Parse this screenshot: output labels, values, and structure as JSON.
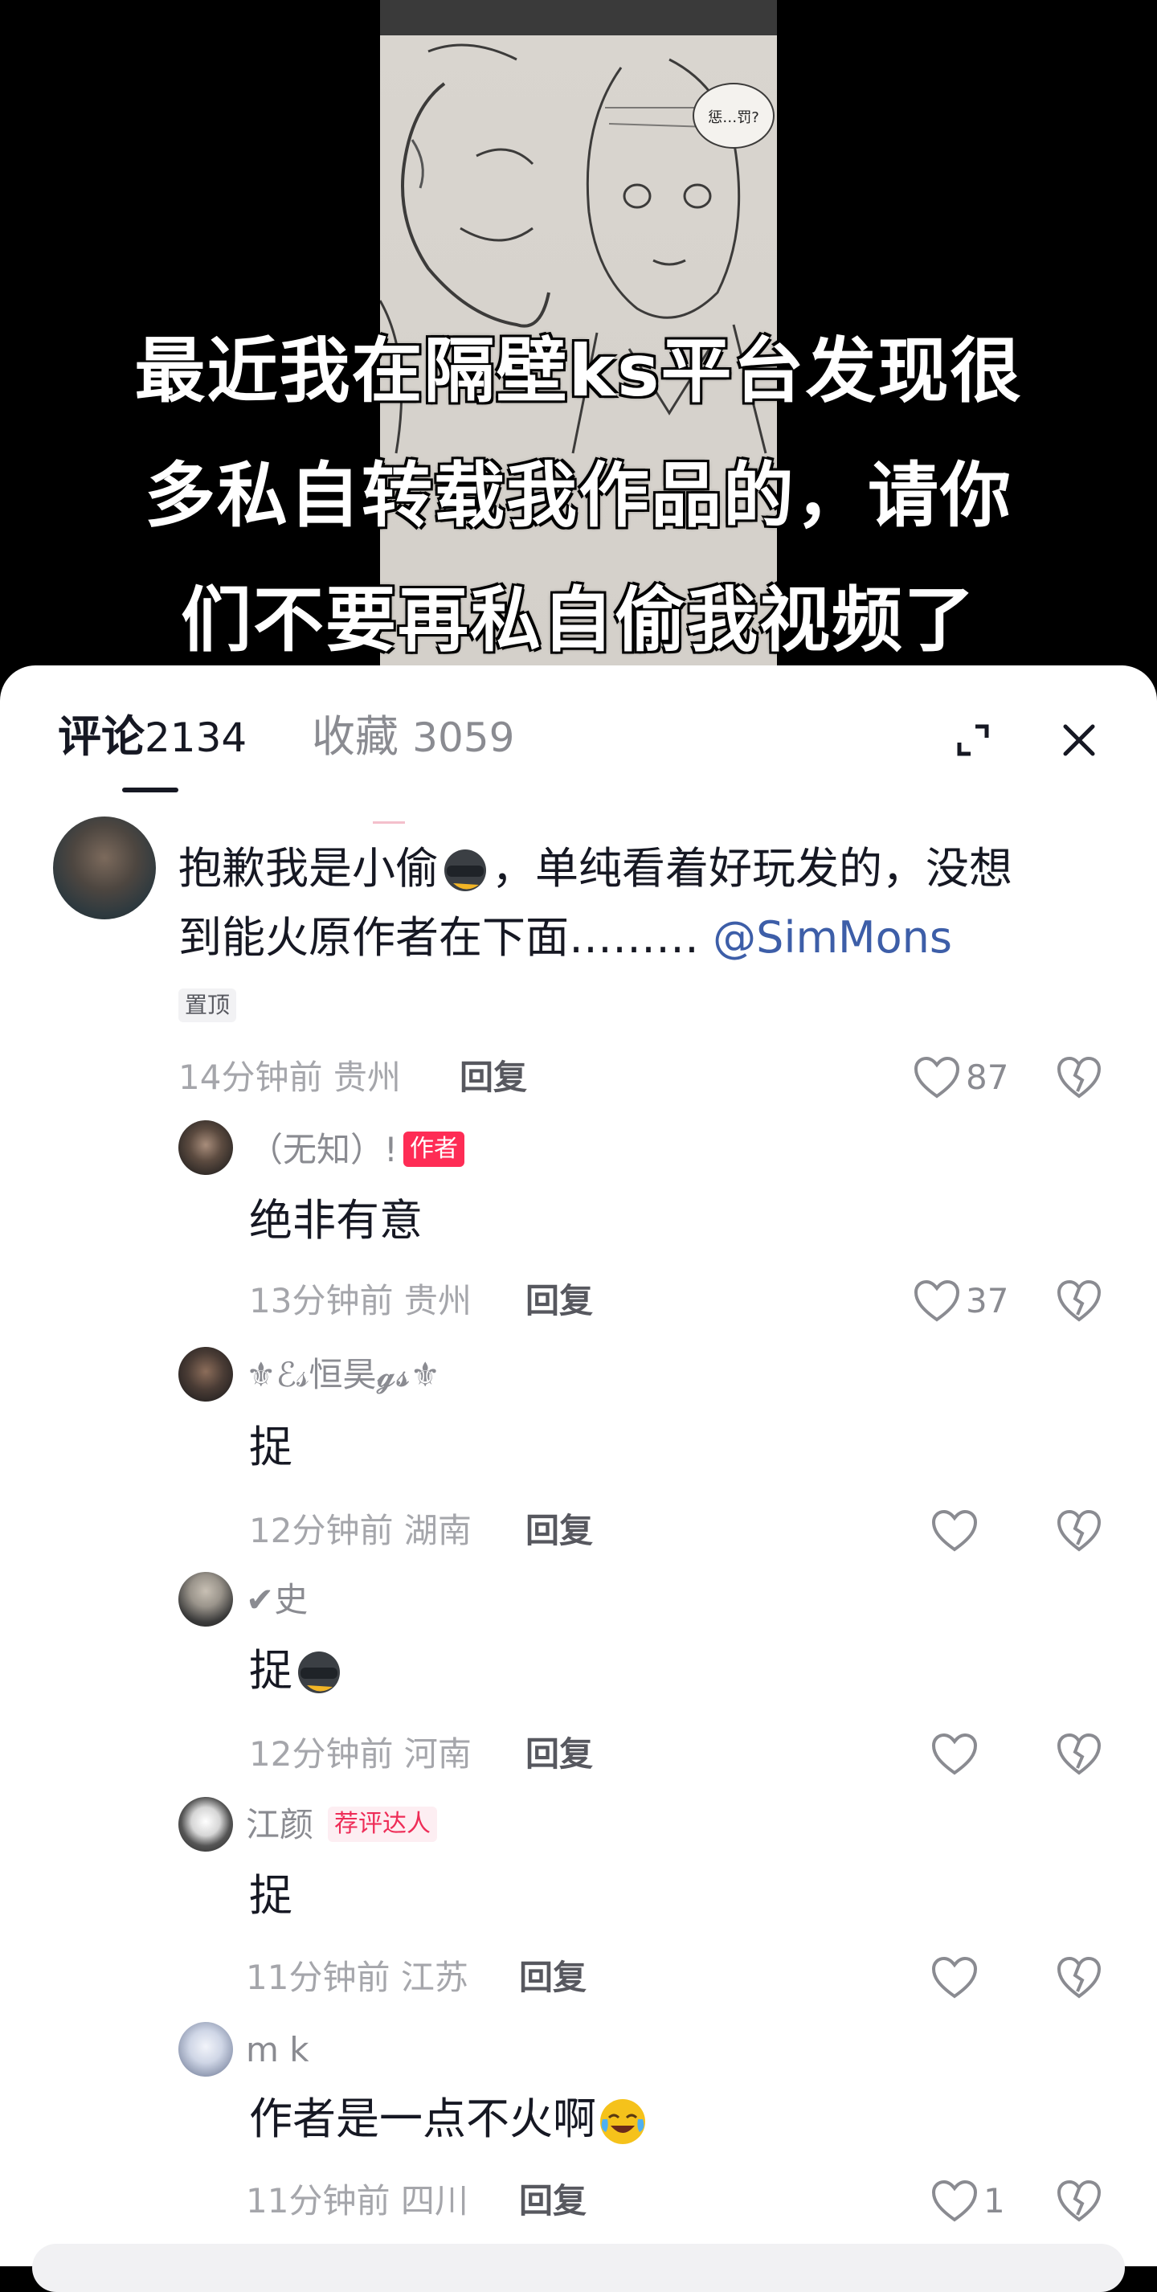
{
  "overlay": {
    "lines": [
      "最近我在隔壁ks平台发现很",
      "多私自转载我作品的，请你",
      "们不要再私自偷我视频了"
    ],
    "bubble_text": "惩…罚?"
  },
  "tabs": {
    "comments_label": "评论",
    "comments_count": "2134",
    "favorites_label": "收藏",
    "favorites_count": "3059"
  },
  "icons": {
    "expand": "expand-icon",
    "close": "close-icon",
    "like": "heart-outline-icon",
    "dislike": "broken-heart-icon"
  },
  "comments": [
    {
      "text_line1": "抱歉我是小偷",
      "text_line1_after": "，单纯看着好玩发的，没想",
      "text_line2": "到能火原作者在下面………",
      "mention": "@SimMons",
      "pinned": "置顶",
      "time": "14分钟前",
      "location": "贵州",
      "reply": "回复",
      "likes": "87"
    },
    {
      "name": "（无知）!",
      "badge": "作者",
      "text": "绝非有意",
      "time": "13分钟前",
      "location": "贵州",
      "reply": "回复",
      "likes": "37"
    },
    {
      "name": "⚜ℰ𝓈恒昊𝓰𝓼⚜",
      "text": "捉",
      "time": "12分钟前",
      "location": "湖南",
      "reply": "回复",
      "likes": ""
    },
    {
      "name": "✔史",
      "text": "捉",
      "time": "12分钟前",
      "location": "河南",
      "reply": "回复",
      "likes": ""
    },
    {
      "name": "江颜",
      "badge": "荐评达人",
      "text": "捉",
      "time": "11分钟前",
      "location": "江苏",
      "reply": "回复",
      "likes": ""
    },
    {
      "name": "m  k",
      "text": "作者是一点不火啊",
      "time": "11分钟前",
      "location": "四川",
      "reply": "回复",
      "likes": "1"
    }
  ],
  "colors": {
    "accent": "#fe2c55",
    "mention": "#3d5ea8",
    "meta_text": "#a5a6ab"
  }
}
